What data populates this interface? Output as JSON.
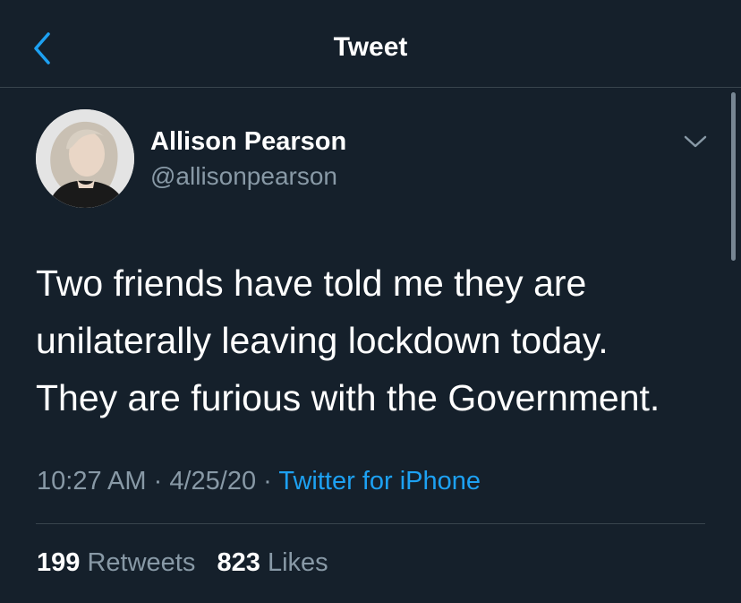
{
  "header": {
    "title": "Tweet",
    "back_icon": "chevron-left-icon",
    "accent_color": "#1da1f2"
  },
  "tweet": {
    "author": {
      "name": "Allison Pearson",
      "handle": "@allisonpearson"
    },
    "text": "Two friends have told me they are\nunilaterally leaving lockdown today.\nThey are furious with the Government.",
    "time": "10:27 AM",
    "separator": "·",
    "date": "4/25/20",
    "source": "Twitter for iPhone"
  },
  "stats": {
    "retweets_count": "199",
    "retweets_label": "Retweets",
    "likes_count": "823",
    "likes_label": "Likes"
  },
  "colors": {
    "background": "#15202b",
    "secondary_text": "#8899a6",
    "divider": "#38444d",
    "link": "#1da1f2"
  }
}
